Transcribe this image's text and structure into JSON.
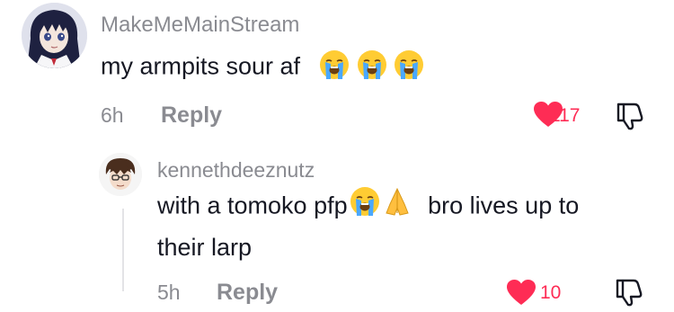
{
  "comments": [
    {
      "username": "MakeMeMainStream",
      "text": "my armpits sour af",
      "emojis": [
        "loudly-crying-face",
        "loudly-crying-face",
        "loudly-crying-face"
      ],
      "time": "6h",
      "reply_label": "Reply",
      "likes": "117",
      "liked": true
    },
    {
      "username": "kennethdeeznutz",
      "text_part1": "with a tomoko pfp",
      "emojis": [
        "loudly-crying-face",
        "folded-hands"
      ],
      "text_part2": "bro lives up to",
      "text_part3": "their larp",
      "time": "5h",
      "reply_label": "Reply",
      "likes": "10",
      "liked": true
    }
  ],
  "colors": {
    "username": "#8a8b91",
    "text": "#161823",
    "like": "#fe2c55",
    "thread_line": "#e3e3e6"
  }
}
